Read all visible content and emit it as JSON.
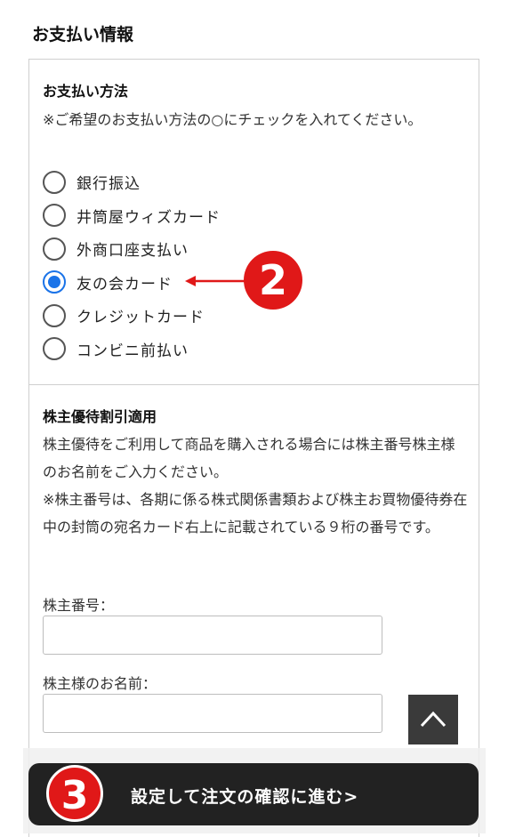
{
  "section_title": "お支払い情報",
  "payment_method": {
    "heading": "お支払い方法",
    "note": "※ご希望のお支払い方法の○にチェックを入れてください。",
    "options": [
      {
        "label": "銀行振込",
        "checked": false
      },
      {
        "label": "井筒屋ウィズカード",
        "checked": false
      },
      {
        "label": "外商口座支払い",
        "checked": false
      },
      {
        "label": "友の会カード",
        "checked": true
      },
      {
        "label": "クレジットカード",
        "checked": false
      },
      {
        "label": "コンビニ前払い",
        "checked": false
      }
    ]
  },
  "shareholder": {
    "heading": "株主優待割引適用",
    "description": "株主優待をご利用して商品を購入される場合には株主番号株主様のお名前をご入力ください。",
    "note": "※株主番号は、各期に係る株式関係書類および株主お買物優待券在中の封筒の宛名カード右上に記載されている９桁の番号です。",
    "number_label": "株主番号：",
    "number_value": "",
    "name_label": "株主様のお名前：",
    "name_value": ""
  },
  "scroll_top_icon": "chevron-up-icon",
  "confirm_button_label": "設定して注文の確認に進む>",
  "annotations": {
    "badge_2": "2",
    "badge_3": "3",
    "color": "#e01818"
  },
  "colors": {
    "radio_selected": "#1a73e8",
    "button_bg": "#222222"
  }
}
